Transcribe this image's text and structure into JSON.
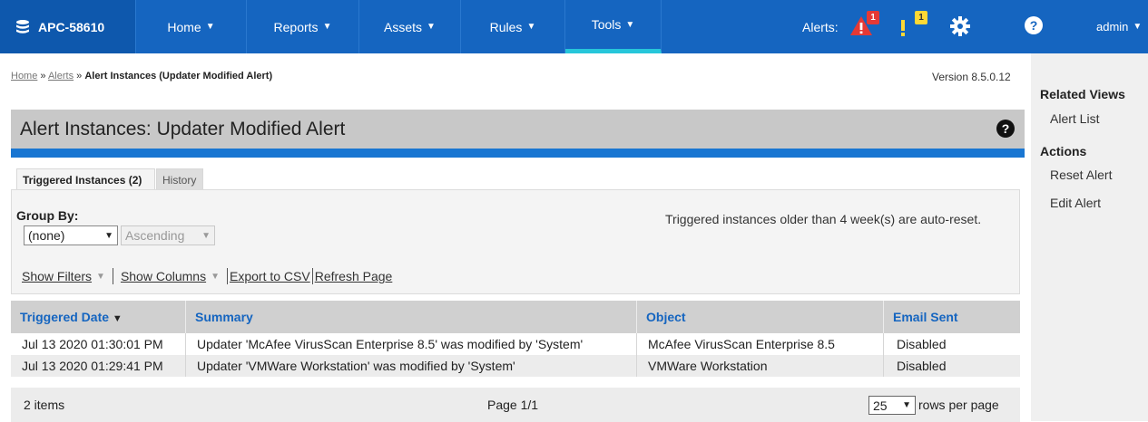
{
  "nav": {
    "brand": "APC-58610",
    "items": [
      {
        "label": "Home"
      },
      {
        "label": "Reports"
      },
      {
        "label": "Assets"
      },
      {
        "label": "Rules"
      },
      {
        "label": "Tools"
      }
    ],
    "active_item": "Tools",
    "alerts_label": "Alerts:",
    "alert_red_count": "1",
    "alert_yellow_count": "1",
    "user": "admin",
    "colors": {
      "bar": "#1565c0",
      "active_underline": "#26c6da"
    }
  },
  "breadcrumb": {
    "home": "Home",
    "sep1": " » ",
    "alerts": "Alerts",
    "sep2": " » ",
    "current": "Alert Instances (Updater Modified Alert)"
  },
  "version": "Version 8.5.0.12",
  "page_title": "Alert Instances: Updater Modified Alert",
  "tabs": [
    {
      "label": "Triggered Instances (2)",
      "active": true
    },
    {
      "label": "History",
      "active": false
    }
  ],
  "group_by": {
    "label": "Group By:",
    "selected": "(none)",
    "order": "Ascending"
  },
  "auto_reset_note": "Triggered instances older than 4 week(s) are auto-reset.",
  "links": {
    "show_filters": "Show Filters",
    "show_columns": "Show Columns",
    "export_csv": "Export to CSV",
    "refresh": "Refresh Page"
  },
  "table": {
    "columns": [
      "Triggered Date",
      "Summary",
      "Object",
      "Email Sent"
    ],
    "sort_indicator": "▼",
    "rows": [
      [
        "Jul 13 2020 01:30:01 PM",
        "Updater 'McAfee VirusScan Enterprise 8.5' was modified by 'System'",
        "McAfee VirusScan Enterprise 8.5",
        "Disabled"
      ],
      [
        "Jul 13 2020 01:29:41 PM",
        "Updater 'VMWare Workstation' was modified by 'System'",
        "VMWare Workstation",
        "Disabled"
      ]
    ],
    "items_count": "2 items",
    "page_info": "Page 1/1",
    "rows_per_page_value": "25",
    "rows_per_page_label": "rows per page"
  },
  "side": {
    "related_heading": "Related Views",
    "related_links": [
      "Alert List"
    ],
    "actions_heading": "Actions",
    "action_links": [
      "Reset Alert",
      "Edit Alert"
    ]
  }
}
